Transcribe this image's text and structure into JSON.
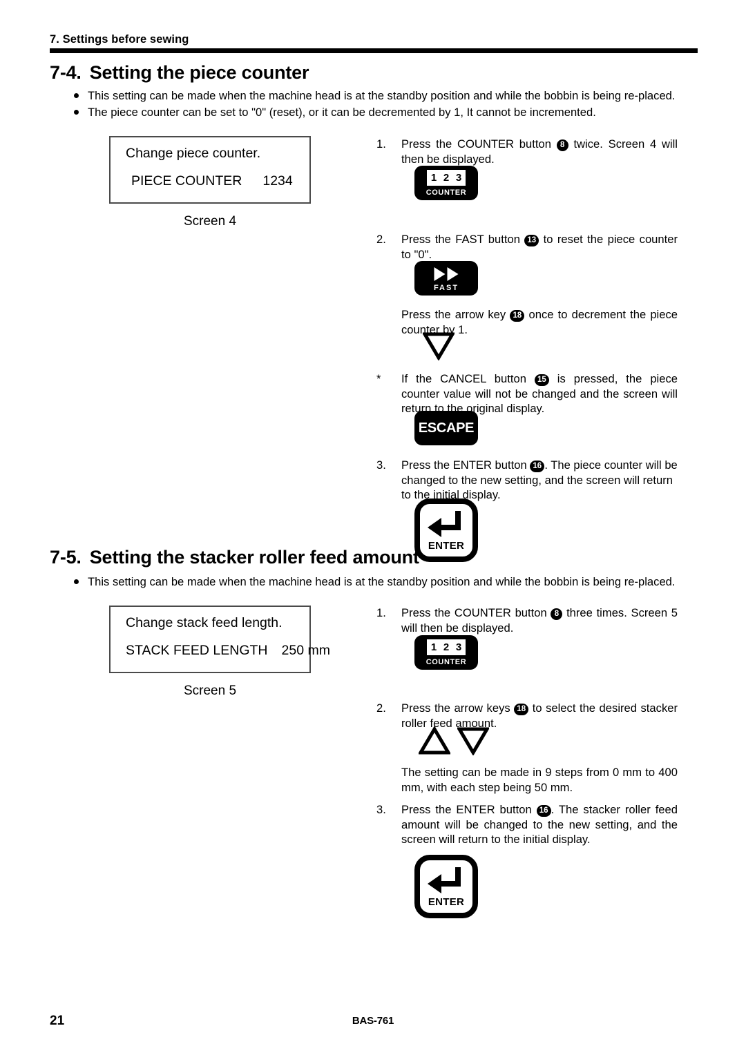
{
  "header": {
    "running_head": "7. Settings before sewing"
  },
  "sections": [
    {
      "number": "7-4.",
      "title": "Setting the piece counter",
      "bullets": [
        "This setting can be made when the machine head is at the standby position and while the bobbin is being re-placed.",
        "The piece counter can be set to \"0\" (reset), or it can be decremented by 1, It cannot be incremented."
      ],
      "screen": {
        "line1": "Change piece counter.",
        "label": "PIECE COUNTER",
        "value": "1234",
        "caption": "Screen 4"
      },
      "steps": [
        {
          "label": "1.",
          "text_before": "Press the COUNTER button ",
          "callout": "8",
          "text_after": " twice. Screen 4 will then be displayed.",
          "key": "counter-button"
        },
        {
          "label": "2.",
          "text_before": "Press the FAST button ",
          "callout": "13",
          "text_after": " to reset the piece counter to \"0\".",
          "key": "fast-button"
        }
      ],
      "notes": [
        {
          "label": "",
          "text_before": "Press the arrow key ",
          "callout": "18",
          "text_after": " once to decrement the piece counter by 1.",
          "key": "down-arrow-key"
        },
        {
          "label": "*",
          "text_before": "If the CANCEL button ",
          "callout": "15",
          "text_after": " is pressed, the piece counter value will not be changed and the screen will return to the original display.",
          "key": "escape-button"
        },
        {
          "label": "3.",
          "text_before": "Press the ENTER button ",
          "callout": "16",
          "text_after": ". The piece counter will be changed to the new setting, and the screen will return to the initial display.",
          "key": "enter-button"
        }
      ]
    },
    {
      "number": "7-5.",
      "title": "Setting the stacker roller feed amount",
      "bullets": [
        "This setting can be made when the machine head is at the standby position and while the bobbin is being re-placed."
      ],
      "screen": {
        "line1": "Change stack feed length.",
        "label": "STACK FEED LENGTH",
        "value": "250 mm",
        "caption": "Screen 5"
      },
      "steps": [
        {
          "label": "1.",
          "text_before": "Press the COUNTER button ",
          "callout": "8",
          "text_after": " three times. Screen 5 will then be displayed.",
          "key": "counter-button"
        },
        {
          "label": "2.",
          "text_before": "Press the arrow keys ",
          "callout": "18",
          "text_after": " to select the desired stacker roller feed amount.",
          "key": "up-down-arrow-keys"
        }
      ],
      "notes": [
        {
          "label": "",
          "text": "The setting can be made in 9 steps from 0 mm to 400 mm, with each step being 50 mm."
        },
        {
          "label": "3.",
          "text_before": "Press the ENTER button ",
          "callout": "16",
          "text_after": ". The stacker roller feed amount will be changed to the new setting, and the screen will return to the initial display.",
          "key": "enter-button"
        }
      ]
    }
  ],
  "keys": {
    "counter": {
      "digits": [
        "1",
        "2",
        "3"
      ],
      "caption": "COUNTER"
    },
    "fast": {
      "caption": "FAST"
    },
    "escape": {
      "caption": "ESCAPE"
    },
    "enter": {
      "caption": "ENTER"
    }
  },
  "footer": {
    "page_number": "21",
    "document": "BAS-761"
  },
  "colors": {
    "ink": "#000000",
    "paper": "#ffffff",
    "lcd_border": "#4a4a4a"
  }
}
